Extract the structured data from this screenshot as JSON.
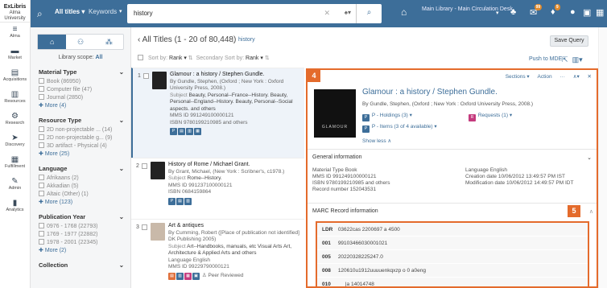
{
  "logo": {
    "brand": "ExLibris",
    "sub": "Alma University"
  },
  "nav": [
    {
      "label": "Alma",
      "icon": "≡"
    },
    {
      "label": "Market",
      "icon": "▬"
    },
    {
      "label": "Acquisitions",
      "icon": "▤"
    },
    {
      "label": "Resources",
      "icon": "▥"
    },
    {
      "label": "Research",
      "icon": "⚙"
    },
    {
      "label": "Discovery",
      "icon": "➤"
    },
    {
      "label": "Fulfillment",
      "icon": "▦"
    },
    {
      "label": "Admin",
      "icon": "✎"
    },
    {
      "label": "Analytics",
      "icon": "▮"
    }
  ],
  "topbar": {
    "scope": "All titles ▾",
    "keywords": "Keywords",
    "search_value": "history",
    "desk": "Main Library - Main Circulation Desk",
    "badge1": "99",
    "badge2": "9"
  },
  "facets": {
    "library_scope_label": "Library scope:",
    "library_scope_value": "All",
    "groups": [
      {
        "title": "Material Type",
        "options": [
          "Book (86950)",
          "Computer file (47)",
          "Journal (2850)"
        ],
        "more": "More (4)"
      },
      {
        "title": "Resource Type",
        "options": [
          "2D non-projectable ... (14)",
          "2D non-projectable g... (9)",
          "3D artifact - Physical (4)"
        ],
        "more": "More (25)"
      },
      {
        "title": "Language",
        "options": [
          "Afrikaans (2)",
          "Akkadian (5)",
          "Altaic (Other) (1)"
        ],
        "more": "More (123)"
      },
      {
        "title": "Publication Year",
        "options": [
          "0976 - 1768 (22793)",
          "1769 - 1977 (22882)",
          "1978 - 2001 (22345)"
        ],
        "more": "More (2)"
      },
      {
        "title": "Collection",
        "options": [],
        "more": ""
      }
    ]
  },
  "results": {
    "title": "All Titles (1 - 20 of 80,448)",
    "query": "history",
    "sort_label": "Sort by:",
    "sort_value": "Rank ▾",
    "secondary_label": "Secondary Sort by:",
    "secondary_value": "Rank ▾",
    "save_query": "Save Query",
    "push_mde": "Push to MDE",
    "records": [
      {
        "num": "1",
        "title": "Glamour : a history / Stephen Gundle.",
        "by": "By Gundle, Stephen, (Oxford ; New York : Oxford University Press, 2008.)",
        "subject_label": "Subject",
        "subject": "Beauty, Personal--France--History. Beauty, Personal--England--History. Beauty, Personal--Social aspects. and others",
        "mms": "MMS ID 991249100000121",
        "isbn": "ISBN 9780199210985 and others"
      },
      {
        "num": "2",
        "title": "History of Rome / Michael Grant.",
        "by": "By Grant, Michael, (New York : Scribner's, c1978.)",
        "subject_label": "Subject",
        "subject": "Rome--History.",
        "mms": "MMS ID 991237100000121",
        "isbn": "ISBN 0684159864"
      },
      {
        "num": "3",
        "title": "Art & antiques",
        "by": "By Cumming, Robert ([Place of publication not identified] DK Publishing 2005)",
        "subject_label": "Subject",
        "subject": "Art--Handbooks, manuals, etc Visual Arts Art, Architecture & Applied Arts and others",
        "language": "Language English",
        "mms": "MMS ID 99229790000121",
        "peer": "Peer Reviewed"
      }
    ]
  },
  "detail": {
    "callout": "4",
    "toolbar": {
      "sections": "Sections ▾",
      "action": "Action",
      "more": "···",
      "close": "✕"
    },
    "title": "Glamour : a history / Stephen Gundle.",
    "author": "By Gundle, Stephen, (Oxford ; New York : Oxford University Press, 2008.)",
    "holdings": "P - Holdings (3) ▾",
    "items": "P - Items (3 of 4 available) ▾",
    "requests": "Requests (1) ▾",
    "show_less": "Show less ∧",
    "thumb_text": "GLAMOUR",
    "general_title": "General information",
    "gi_left": [
      "Material Type Book",
      "MMS ID 991249100000121",
      "ISBN 9780199210985 and others",
      "Record number 152043531"
    ],
    "gi_right": [
      "Language English",
      "Creation date 10/06/2012 13:49:57 PM IST",
      "Modification date 10/06/2012 14:49:57 PM IDT"
    ],
    "marc_title": "MARC Record information",
    "marc_callout": "5",
    "marc": [
      {
        "tag": "LDR",
        "val": "03622cas 2200697 a 4500"
      },
      {
        "tag": "001",
        "val": "99103466030001021"
      },
      {
        "tag": "005",
        "val": "20220328225247.0"
      },
      {
        "tag": "008",
        "val": "120610u1912uuuuenkqxzp o 0 a0eng"
      },
      {
        "tag": "010",
        "val": "__ |a 14014748"
      }
    ]
  }
}
